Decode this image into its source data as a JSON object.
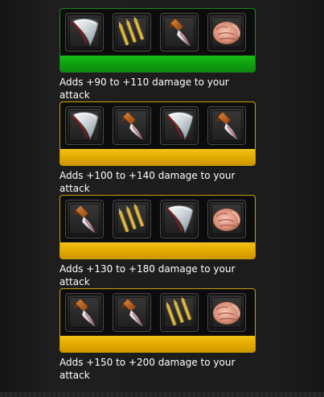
{
  "combos": [
    {
      "status": "active",
      "items": [
        "blade-icon",
        "bullets-icon",
        "knife-icon",
        "fist-icon"
      ],
      "description": "Adds +90 to +110 damage to your attack"
    },
    {
      "status": "available",
      "items": [
        "blade-icon",
        "knife-icon",
        "blade-icon",
        "knife-icon"
      ],
      "description": "Adds +100 to +140 damage to your attack"
    },
    {
      "status": "available",
      "items": [
        "knife-icon",
        "bullets-icon",
        "blade-icon",
        "fist-icon"
      ],
      "description": "Adds +130 to +180 damage to your attack"
    },
    {
      "status": "available",
      "items": [
        "knife-icon",
        "knife-icon",
        "bullets-icon",
        "fist-icon"
      ],
      "description": "Adds +150 to +200 damage to your attack"
    }
  ],
  "colors": {
    "active_bar": "#0fa00f",
    "active_border": "#1b8a1b",
    "available_bar": "#e3ab00",
    "available_border": "#c7a000",
    "slot_bg": "#2a2a2a",
    "text": "#ffffff",
    "page_bg": "#1c1c1c"
  }
}
